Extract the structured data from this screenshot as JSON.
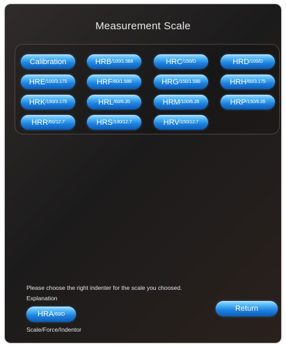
{
  "title": "Measurement Scale",
  "scales": [
    {
      "label": "Calibration",
      "main": "",
      "sub": ""
    },
    {
      "label": "",
      "main": "HRB",
      "sub": "/100/1.588"
    },
    {
      "label": "",
      "main": "HRC",
      "sub": "/150/D"
    },
    {
      "label": "",
      "main": "HRD",
      "sub": "/100/D"
    },
    {
      "label": "",
      "main": "HRE",
      "sub": "/100/3.175"
    },
    {
      "label": "",
      "main": "HRF",
      "sub": "/60/1.588"
    },
    {
      "label": "",
      "main": "HRG",
      "sub": "/150/1.588"
    },
    {
      "label": "",
      "main": "HRH",
      "sub": "/60/3.175"
    },
    {
      "label": "",
      "main": "HRK",
      "sub": "/150/3.175"
    },
    {
      "label": "",
      "main": "HRL",
      "sub": "/60/6.35"
    },
    {
      "label": "",
      "main": "HRM",
      "sub": "/100/6.35"
    },
    {
      "label": "",
      "main": "HRP",
      "sub": "/150/6.35"
    },
    {
      "label": "",
      "main": "HRR",
      "sub": "/60/12.7"
    },
    {
      "label": "",
      "main": "HRS",
      "sub": "/100/12.7"
    },
    {
      "label": "",
      "main": "HRV",
      "sub": "/150/12.7"
    }
  ],
  "instruction": "Please choose the right indenter for the scale you choosed.",
  "explanation_label": "Explanation",
  "sample": {
    "main": "HRA",
    "sub": "/60/D"
  },
  "format_hint": "Scale/Force/Indentor",
  "return_label": "Return"
}
